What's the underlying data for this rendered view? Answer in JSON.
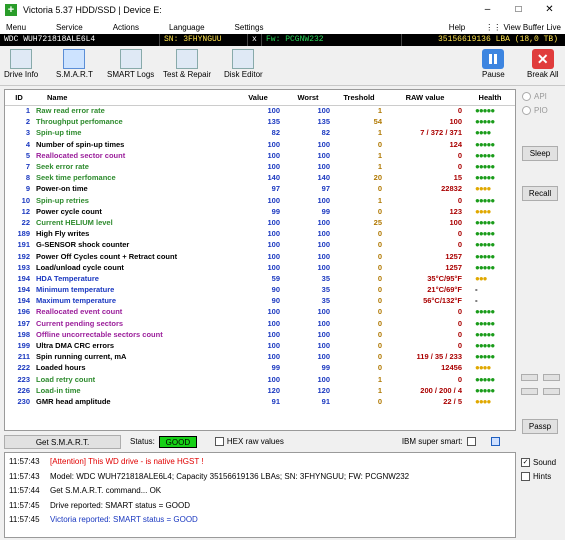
{
  "window": {
    "title": "Victoria 5.37 HDD/SSD | Device E:",
    "min": "–",
    "max": "□",
    "close": "✕"
  },
  "menu": {
    "items": [
      "Menu",
      "Service",
      "Actions",
      "Language",
      "Settings"
    ],
    "help": "Help",
    "view_buffer": "View Buffer Live"
  },
  "info": {
    "model": "WDC  WUH721818ALE6L4",
    "serial": "SN: 3FHYNGUU",
    "close": "x",
    "firmware": "Fw: PCGNW232",
    "capacity": "35156619136 LBA (18,0 TB)"
  },
  "toolbar": {
    "drive_info": "Drive Info",
    "smart": "S.M.A.R.T",
    "smart_logs": "SMART Logs",
    "test_repair": "Test & Repair",
    "disk_editor": "Disk Editor",
    "pause": "Pause",
    "break_all": "Break All"
  },
  "table": {
    "headers": [
      "ID",
      "Name",
      "Value",
      "Worst",
      "Treshold",
      "RAW value",
      "Health"
    ],
    "rows": [
      {
        "id": "1",
        "name": "Raw read error rate",
        "value": "100",
        "worst": "100",
        "thr": "1",
        "raw": "0",
        "health": "●●●●●",
        "c": "green",
        "h": "hgreen"
      },
      {
        "id": "2",
        "name": "Throughput perfomance",
        "value": "135",
        "worst": "135",
        "thr": "54",
        "raw": "100",
        "health": "●●●●●",
        "c": "green",
        "h": "hgreen"
      },
      {
        "id": "3",
        "name": "Spin-up time",
        "value": "82",
        "worst": "82",
        "thr": "1",
        "raw": "7 / 372 / 371",
        "health": "●●●●",
        "c": "green",
        "h": "hgreen"
      },
      {
        "id": "4",
        "name": "Number of spin-up times",
        "value": "100",
        "worst": "100",
        "thr": "0",
        "raw": "124",
        "health": "●●●●●",
        "c": "black",
        "h": "hgreen"
      },
      {
        "id": "5",
        "name": "Reallocated sector count",
        "value": "100",
        "worst": "100",
        "thr": "1",
        "raw": "0",
        "health": "●●●●●",
        "c": "purple",
        "h": "hgreen"
      },
      {
        "id": "7",
        "name": "Seek error rate",
        "value": "100",
        "worst": "100",
        "thr": "1",
        "raw": "0",
        "health": "●●●●●",
        "c": "green",
        "h": "hgreen"
      },
      {
        "id": "8",
        "name": "Seek time perfomance",
        "value": "140",
        "worst": "140",
        "thr": "20",
        "raw": "15",
        "health": "●●●●●",
        "c": "green",
        "h": "hgreen"
      },
      {
        "id": "9",
        "name": "Power-on time",
        "value": "97",
        "worst": "97",
        "thr": "0",
        "raw": "22832",
        "health": "●●●●",
        "c": "black",
        "h": "hyellow"
      },
      {
        "id": "10",
        "name": "Spin-up retries",
        "value": "100",
        "worst": "100",
        "thr": "1",
        "raw": "0",
        "health": "●●●●●",
        "c": "green",
        "h": "hgreen"
      },
      {
        "id": "12",
        "name": "Power cycle count",
        "value": "99",
        "worst": "99",
        "thr": "0",
        "raw": "123",
        "health": "●●●●",
        "c": "black",
        "h": "hyellow"
      },
      {
        "id": "22",
        "name": "Current HELIUM level",
        "value": "100",
        "worst": "100",
        "thr": "25",
        "raw": "100",
        "health": "●●●●●",
        "c": "green",
        "h": "hgreen"
      },
      {
        "id": "189",
        "name": "High Fly writes",
        "value": "100",
        "worst": "100",
        "thr": "0",
        "raw": "0",
        "health": "●●●●●",
        "c": "black",
        "h": "hgreen"
      },
      {
        "id": "191",
        "name": "G-SENSOR shock counter",
        "value": "100",
        "worst": "100",
        "thr": "0",
        "raw": "0",
        "health": "●●●●●",
        "c": "black",
        "h": "hgreen"
      },
      {
        "id": "192",
        "name": "Power Off Cycles count + Retract count",
        "value": "100",
        "worst": "100",
        "thr": "0",
        "raw": "1257",
        "health": "●●●●●",
        "c": "black",
        "h": "hgreen"
      },
      {
        "id": "193",
        "name": "Load/unload cycle count",
        "value": "100",
        "worst": "100",
        "thr": "0",
        "raw": "1257",
        "health": "●●●●●",
        "c": "black",
        "h": "hgreen"
      },
      {
        "id": "194",
        "name": "HDA Temperature",
        "value": "59",
        "worst": "35",
        "thr": "0",
        "raw": "35°C/95°F",
        "health": "●●●",
        "c": "blue",
        "h": "hyellow"
      },
      {
        "id": "194",
        "name": "Minimum temperature",
        "value": "90",
        "worst": "35",
        "thr": "0",
        "raw": "21°C/69°F",
        "health": "-",
        "c": "blue",
        "h": "black"
      },
      {
        "id": "194",
        "name": "Maximum temperature",
        "value": "90",
        "worst": "35",
        "thr": "0",
        "raw": "56°C/132°F",
        "health": "-",
        "c": "blue",
        "h": "black"
      },
      {
        "id": "196",
        "name": "Reallocated event count",
        "value": "100",
        "worst": "100",
        "thr": "0",
        "raw": "0",
        "health": "●●●●●",
        "c": "purple",
        "h": "hgreen"
      },
      {
        "id": "197",
        "name": "Current pending sectors",
        "value": "100",
        "worst": "100",
        "thr": "0",
        "raw": "0",
        "health": "●●●●●",
        "c": "purple",
        "h": "hgreen"
      },
      {
        "id": "198",
        "name": "Offline uncorrectable sectors count",
        "value": "100",
        "worst": "100",
        "thr": "0",
        "raw": "0",
        "health": "●●●●●",
        "c": "purple",
        "h": "hgreen"
      },
      {
        "id": "199",
        "name": "Ultra DMA CRC errors",
        "value": "100",
        "worst": "100",
        "thr": "0",
        "raw": "0",
        "health": "●●●●●",
        "c": "black",
        "h": "hgreen"
      },
      {
        "id": "211",
        "name": "Spin running current, mA",
        "value": "100",
        "worst": "100",
        "thr": "0",
        "raw": "119 / 35 / 233",
        "health": "●●●●●",
        "c": "black",
        "h": "hgreen"
      },
      {
        "id": "222",
        "name": "Loaded hours",
        "value": "99",
        "worst": "99",
        "thr": "0",
        "raw": "12456",
        "health": "●●●●",
        "c": "black",
        "h": "hyellow"
      },
      {
        "id": "223",
        "name": "Load retry count",
        "value": "100",
        "worst": "100",
        "thr": "1",
        "raw": "0",
        "health": "●●●●●",
        "c": "green",
        "h": "hgreen"
      },
      {
        "id": "226",
        "name": "Load-in time",
        "value": "120",
        "worst": "120",
        "thr": "1",
        "raw": "200 / 200 / 4",
        "health": "●●●●●",
        "c": "green",
        "h": "hgreen"
      },
      {
        "id": "230",
        "name": "GMR head amplitude",
        "value": "91",
        "worst": "91",
        "thr": "0",
        "raw": "22 / 5",
        "health": "●●●●",
        "c": "black",
        "h": "hyellow"
      }
    ]
  },
  "side": {
    "api": "API",
    "pio": "PIO",
    "sleep": "Sleep",
    "recall": "Recall",
    "passp": "Passp"
  },
  "status": {
    "get_smart": "Get S.M.A.R.T.",
    "status_label": "Status:",
    "status_value": "GOOD",
    "hex_raw": "HEX raw values",
    "ibm": "IBM super smart:"
  },
  "log": [
    {
      "time": "11:57:43",
      "msg": "[Attention] This WD drive - is native HGST !",
      "c": "red"
    },
    {
      "time": "11:57:43",
      "msg": "Model: WDC  WUH721818ALE6L4; Capacity 35156619136 LBAs; SN: 3FHYNGUU; FW: PCGNW232",
      "c": "blk"
    },
    {
      "time": "11:57:44",
      "msg": "Get S.M.A.R.T. command... OK",
      "c": "blk"
    },
    {
      "time": "11:57:45",
      "msg": "Drive reported: SMART status = GOOD",
      "c": "blk"
    },
    {
      "time": "11:57:45",
      "msg": "Victoria reported: SMART status = GOOD",
      "c": "blu"
    }
  ],
  "options": {
    "sound": "Sound",
    "hints": "Hints"
  },
  "colors": {
    "good": "#16d016",
    "info_bg": "#000000"
  }
}
